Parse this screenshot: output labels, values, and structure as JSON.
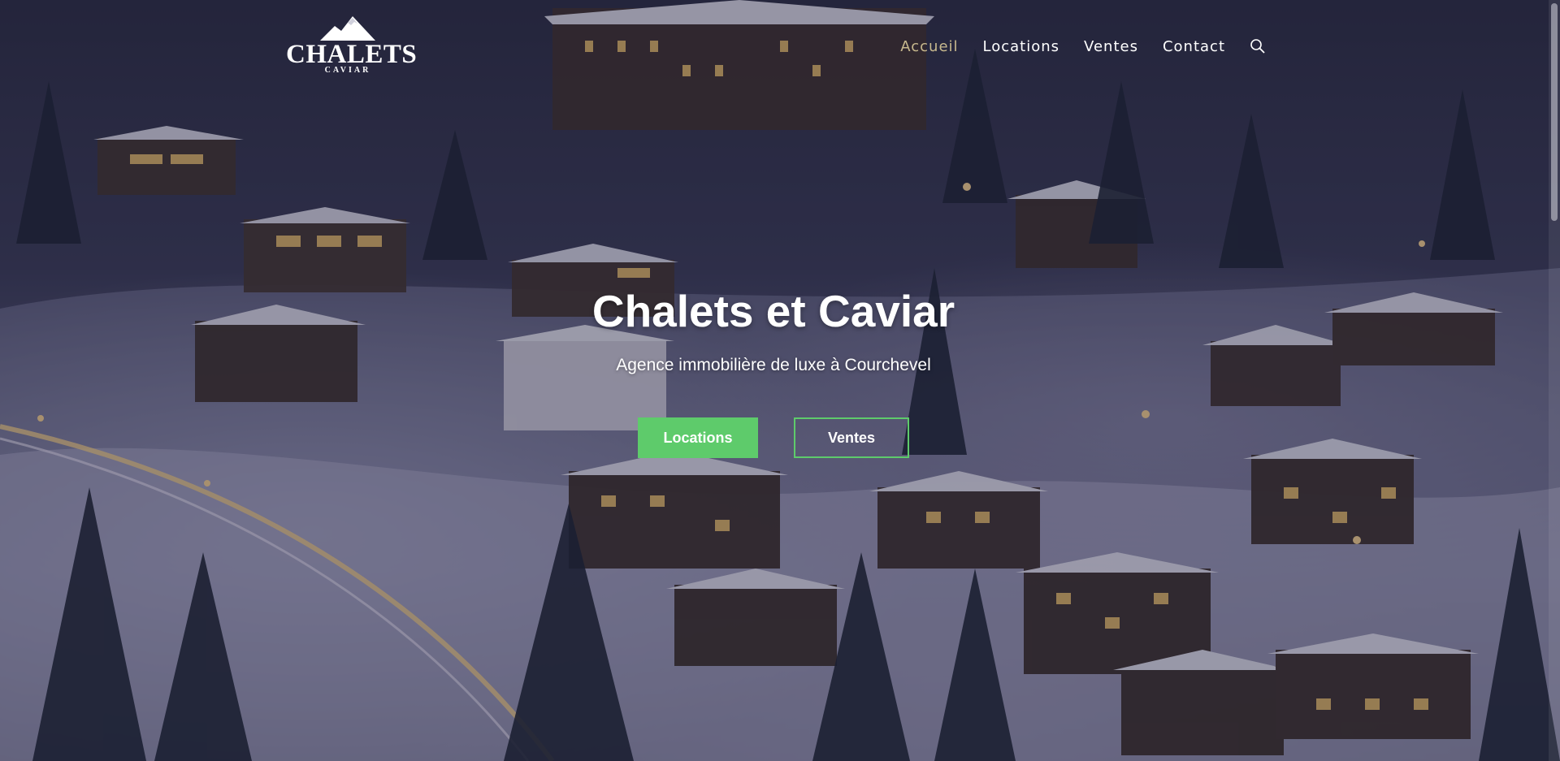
{
  "colors": {
    "accent_green": "#5ecb6b",
    "nav_active": "#c8b98e",
    "text_light": "#ffffff",
    "overlay": "#191937"
  },
  "logo": {
    "main": "CHALETS",
    "sub": "CAVIAR",
    "icon": "mountain-icon"
  },
  "nav": {
    "items": [
      {
        "label": "Accueil",
        "active": true
      },
      {
        "label": "Locations",
        "active": false
      },
      {
        "label": "Ventes",
        "active": false
      },
      {
        "label": "Contact",
        "active": false
      }
    ],
    "search_icon": "search-icon"
  },
  "hero": {
    "title": "Chalets et Caviar",
    "subtitle": "Agence immobilière de luxe à Courchevel",
    "buttons": {
      "locations": "Locations",
      "ventes": "Ventes"
    }
  }
}
